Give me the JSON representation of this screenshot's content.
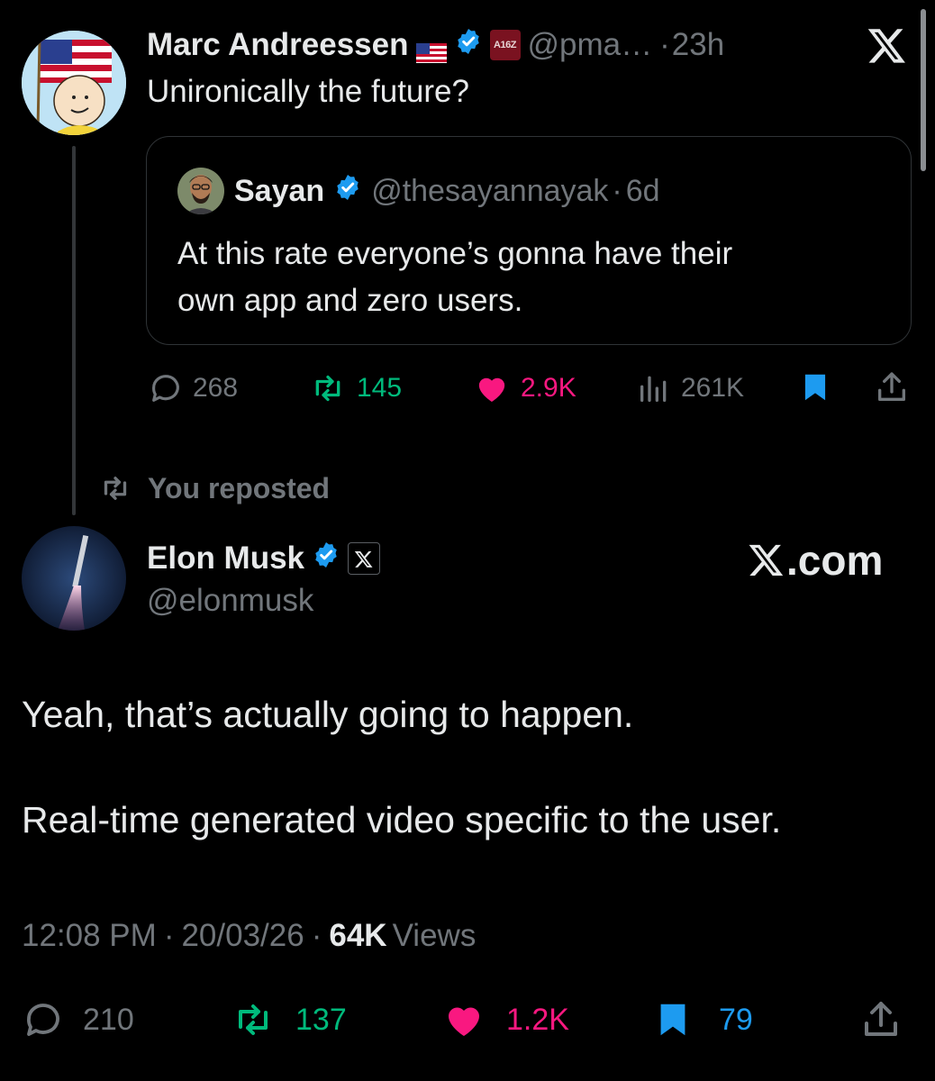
{
  "scrollbar": {},
  "original_post": {
    "author_name": "Marc Andreessen",
    "flag_emoji": "🇺🇸",
    "affiliation_badge": "A16Z",
    "handle": "@pma…",
    "separator": "·",
    "time": "23h",
    "text": "Unironically the future?",
    "quoted": {
      "author_name": "Sayan",
      "handle": "@thesayannayak",
      "separator": "·",
      "time": "6d",
      "text_line1": "At this rate everyone’s gonna have their",
      "text_line2": "own app and zero users."
    },
    "stats": {
      "replies": "268",
      "reposts": "145",
      "likes": "2.9K",
      "views": "261K"
    }
  },
  "repost_banner": {
    "label": "You reposted"
  },
  "reply_post": {
    "author_name": "Elon Musk",
    "handle": "@elonmusk",
    "profile_link": "X.com",
    "text_line1": "Yeah, that’s actually going to happen.",
    "text_line2": "Real-time generated video specific to the user.",
    "meta": {
      "time": "12:08 PM",
      "sep1": "·",
      "date": "20/03/26",
      "sep2": "·",
      "views_count": "64K",
      "views_label": "Views"
    },
    "stats": {
      "replies": "210",
      "reposts": "137",
      "likes": "1.2K",
      "bookmarks": "79"
    }
  },
  "colors": {
    "background": "#000000",
    "text": "#e7e9ea",
    "muted": "#71767b",
    "verified_blue": "#1d9bf0",
    "repost_green": "#00ba7c",
    "like_pink": "#f91880",
    "bookmark_blue": "#1d9bf0"
  }
}
